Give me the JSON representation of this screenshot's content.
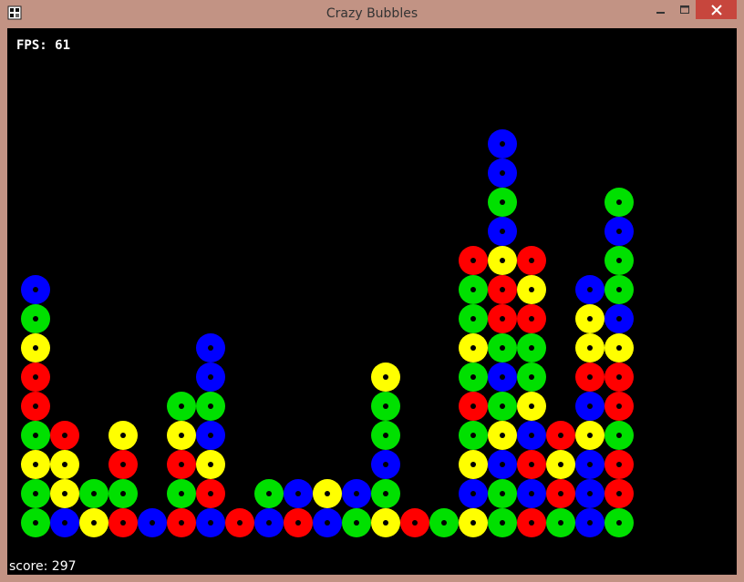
{
  "window": {
    "title": "Crazy Bubbles",
    "icon": "app-icon",
    "controls": [
      "minimize-icon",
      "maximize-icon",
      "close-icon"
    ]
  },
  "hud": {
    "fps_label": "FPS:",
    "fps_value": "61",
    "score_label": "score:",
    "score_value": "297"
  },
  "colors": {
    "G": "#00e000",
    "B": "#0000ff",
    "Y": "#ffff00",
    "R": "#ff0000",
    "window_frame": "#c29384",
    "close_button": "#c7463d",
    "playfield": "#000000"
  },
  "grid": {
    "columns": [
      [
        "G",
        "G",
        "Y",
        "G",
        "R",
        "R",
        "Y",
        "G",
        "B"
      ],
      [
        "B",
        "Y",
        "Y",
        "R"
      ],
      [
        "Y",
        "G"
      ],
      [
        "R",
        "G",
        "R",
        "Y"
      ],
      [
        "B"
      ],
      [
        "R",
        "G",
        "R",
        "Y",
        "G"
      ],
      [
        "B",
        "R",
        "Y",
        "B",
        "G",
        "B",
        "B"
      ],
      [
        "R"
      ],
      [
        "B",
        "G"
      ],
      [
        "R",
        "B"
      ],
      [
        "B",
        "Y"
      ],
      [
        "G",
        "B"
      ],
      [
        "Y",
        "G",
        "B",
        "G",
        "G",
        "Y"
      ],
      [
        "R"
      ],
      [
        "G"
      ],
      [
        "Y",
        "B",
        "Y",
        "G",
        "R",
        "G",
        "Y",
        "G",
        "G",
        "R"
      ],
      [
        "G",
        "G",
        "B",
        "Y",
        "G",
        "B",
        "G",
        "R",
        "R",
        "Y",
        "B",
        "G",
        "B",
        "B"
      ],
      [
        "R",
        "B",
        "R",
        "B",
        "Y",
        "G",
        "G",
        "R",
        "Y",
        "R"
      ],
      [
        "G",
        "R",
        "Y",
        "R"
      ],
      [
        "B",
        "B",
        "B",
        "Y",
        "B",
        "R",
        "Y",
        "Y",
        "B"
      ],
      [
        "G",
        "R",
        "R",
        "G",
        "R",
        "R",
        "Y",
        "B",
        "G",
        "G",
        "B",
        "G"
      ]
    ]
  }
}
